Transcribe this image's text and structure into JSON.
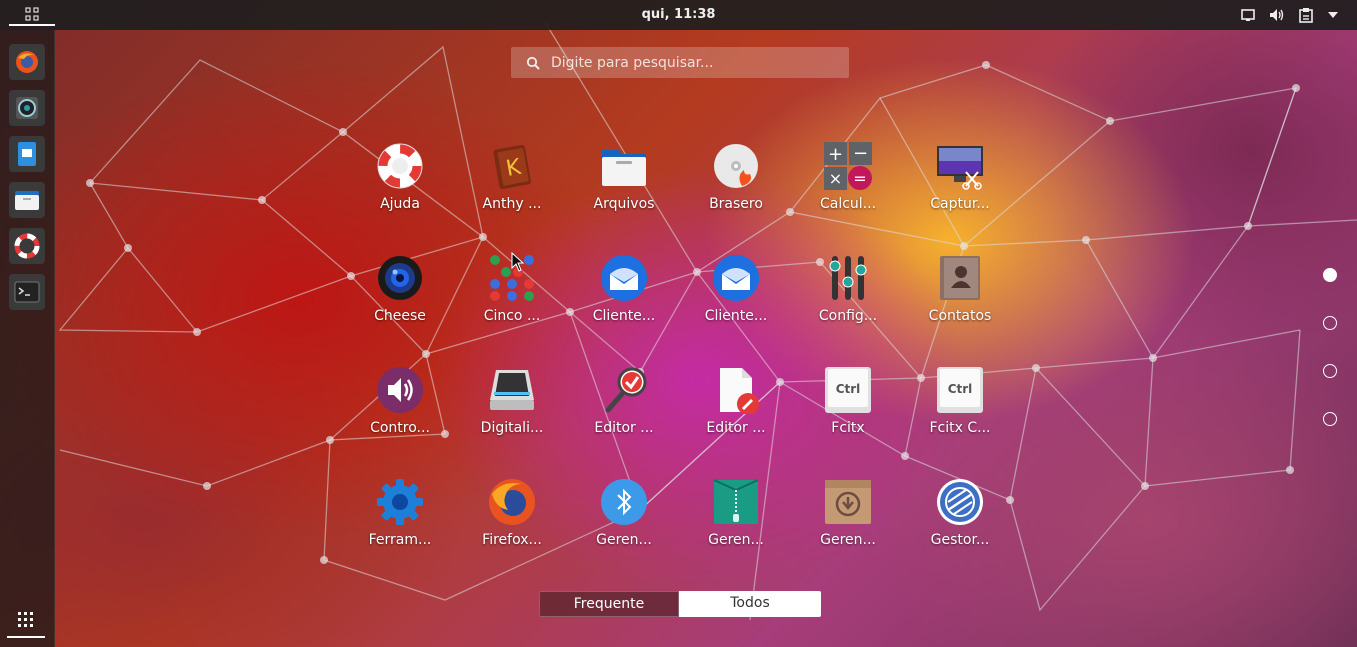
{
  "topbar": {
    "clock": "qui, 11:38",
    "tray_icons": [
      "display-icon",
      "volume-icon",
      "clipboard-icon",
      "chevron-down-icon"
    ]
  },
  "dock": {
    "items": [
      "firefox-icon",
      "camera-icon",
      "document-viewer-icon",
      "files-icon",
      "help-lifebuoy-icon",
      "terminal-icon"
    ],
    "show_apps_icon": "grid-icon"
  },
  "search": {
    "placeholder": "Digite para pesquisar..."
  },
  "apps": [
    {
      "label": "Ajuda",
      "icon": "lifebuoy-icon"
    },
    {
      "label": "Anthy ...",
      "icon": "anthy-book-icon"
    },
    {
      "label": "Arquivos",
      "icon": "folder-icon"
    },
    {
      "label": "Brasero",
      "icon": "disc-burner-icon"
    },
    {
      "label": "Calcul...",
      "icon": "calculator-icon"
    },
    {
      "label": "Captur...",
      "icon": "screenshot-icon"
    },
    {
      "label": "Cheese",
      "icon": "webcam-icon"
    },
    {
      "label": "Cinco ...",
      "icon": "five-dots-game-icon"
    },
    {
      "label": "Cliente...",
      "icon": "mail-client-icon"
    },
    {
      "label": "Cliente...",
      "icon": "mail-client-icon"
    },
    {
      "label": "Config...",
      "icon": "settings-sliders-icon"
    },
    {
      "label": "Contatos",
      "icon": "contacts-book-icon"
    },
    {
      "label": "Contro...",
      "icon": "volume-control-icon"
    },
    {
      "label": "Digitali...",
      "icon": "scanner-icon"
    },
    {
      "label": "Editor ...",
      "icon": "magnifier-check-icon"
    },
    {
      "label": "Editor ...",
      "icon": "text-editor-icon"
    },
    {
      "label": "Fcitx",
      "icon": "ctrl-key-icon"
    },
    {
      "label": "Fcitx C...",
      "icon": "ctrl-key-icon"
    },
    {
      "label": "Ferram...",
      "icon": "gear-icon"
    },
    {
      "label": "Firefox...",
      "icon": "firefox-icon"
    },
    {
      "label": "Geren...",
      "icon": "bluetooth-icon"
    },
    {
      "label": "Geren...",
      "icon": "archive-zip-icon"
    },
    {
      "label": "Geren...",
      "icon": "package-icon"
    },
    {
      "label": "Gestor...",
      "icon": "disk-manager-icon"
    }
  ],
  "pager": {
    "pages": 4,
    "current": 1
  },
  "view_switch": {
    "frequent": "Frequente",
    "all": "Todos",
    "selected": "all"
  }
}
